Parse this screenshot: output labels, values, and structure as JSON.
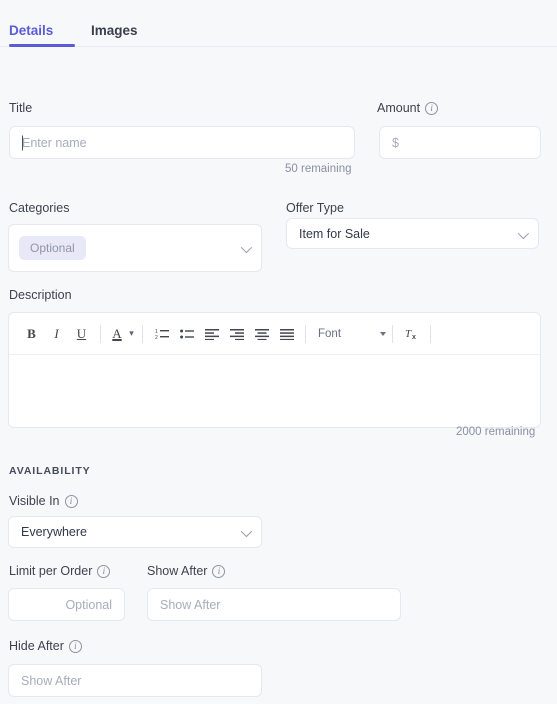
{
  "tabs": [
    {
      "label": "Details",
      "active": true
    },
    {
      "label": "Images",
      "active": false
    }
  ],
  "accent_color": "#5b5bd6",
  "background_color": "#f7f8fa",
  "fields": {
    "title": {
      "label": "Title",
      "placeholder": "Enter name",
      "value": "",
      "helper": "50 remaining",
      "focused": true
    },
    "amount": {
      "label": "Amount",
      "has_info": true,
      "placeholder": "$",
      "value": ""
    },
    "categories": {
      "label": "Categories",
      "chip": "Optional",
      "value": ""
    },
    "offer_type": {
      "label": "Offer Type",
      "value": "Item for Sale",
      "options": [
        "Item for Sale"
      ]
    },
    "description": {
      "label": "Description",
      "value": "",
      "helper": "2000 remaining"
    },
    "visible_in": {
      "label": "Visible In",
      "has_info": true,
      "value": "Everywhere",
      "options": [
        "Everywhere"
      ]
    },
    "limit_per_order": {
      "label": "Limit per Order",
      "has_info": true,
      "placeholder": "Optional",
      "value": ""
    },
    "show_after": {
      "label": "Show After",
      "has_info": true,
      "placeholder": "Show After",
      "value": ""
    },
    "hide_after": {
      "label": "Hide After",
      "has_info": true,
      "placeholder": "Show After",
      "value": ""
    }
  },
  "sections": {
    "availability": "AVAILABILITY"
  },
  "editor_toolbar": {
    "bold": "B",
    "italic": "I",
    "underline": "U",
    "text_color": "A",
    "font_label": "Font",
    "clear_format": "Tx",
    "items": [
      "bold-icon",
      "italic-icon",
      "underline-icon",
      "text-color-icon",
      "numbered-list-icon",
      "bullet-list-icon",
      "align-left-icon",
      "align-right-icon",
      "align-center-icon",
      "align-justify-icon",
      "font-dropdown",
      "clear-format-icon"
    ]
  }
}
